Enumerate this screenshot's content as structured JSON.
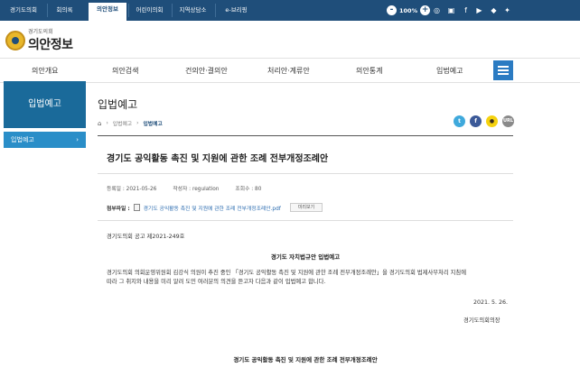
{
  "topbar": {
    "tabs": [
      "경기도의회",
      "회의록",
      "의안정보",
      "어린이의회",
      "지역상담소",
      "e-브리핑"
    ],
    "zoom_minus": "-",
    "zoom_value": "100%",
    "zoom_plus": "+"
  },
  "header": {
    "org": "경기도의회",
    "title": "의안정보"
  },
  "gnb": {
    "items": [
      "의안개요",
      "의안검색",
      "건의안·결의안",
      "처리안·계류안",
      "의안통계",
      "입법예고"
    ]
  },
  "sidebar": {
    "heading": "입법예고",
    "item": "입법예고"
  },
  "page": {
    "title": "입법예고",
    "breadcrumb": [
      "입법예고",
      "입법예고"
    ]
  },
  "share": {
    "twitter": "t",
    "facebook": "f",
    "kakao": "●",
    "url": "URL"
  },
  "document": {
    "title": "경기도 공익활동 촉진 및 지원에 관한 조례 전부개정조례안",
    "date": "등록일 : 2021-05-26",
    "author": "작성자 : regulation",
    "views": "조회수 : 80",
    "attach_label": "첨부파일 :",
    "attach_file": "경기도 공익활동 촉진 및 지원에 관한 조례 전부개정조례안.pdf",
    "preview": "미리보기",
    "notice_no": "경기도의회 공고 제2021-249호",
    "notice_title": "경기도 자치법규안 입법예고",
    "para1": "경기도의회 의회운영위원회 김강식 의원이 추진 중인 「경기도 공익활동 촉진 및 지원에 관한 조례 전부개정조례안」을 경기도의회 법제사무처리 지침에",
    "para2": "따라 그 취지와 내용을 미리 알려 도민 여러분의 의견을 듣고자 다음과 같이 입법예고 합니다.",
    "date_sign": "2021. 5. 26.",
    "signer": "경기도의회의장",
    "bottom_title": "경기도 공익활동 촉진 및 지원에 관한 조례 전부개정조례안"
  },
  "colors": {
    "topbar": "#1f4e7a",
    "sidebar": "#1a6a9a",
    "accent": "#2a8ec8"
  }
}
